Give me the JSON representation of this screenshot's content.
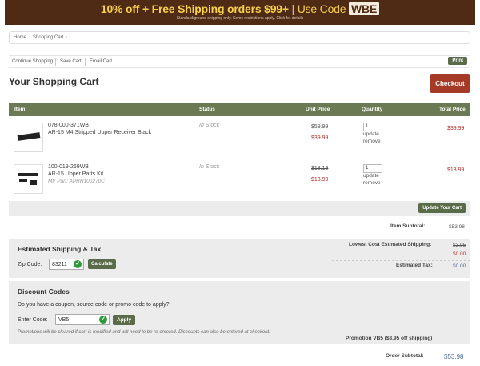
{
  "banner": {
    "headline_a": "10% off",
    "headline_plus": " + ",
    "headline_b": "Free Shipping orders $99+",
    "headline_sep": " | ",
    "headline_code_prefix": "Use Code ",
    "code": "WBE",
    "subtext": "Standard/ground shipping only. Some restrictions apply. Click for details"
  },
  "breadcrumb": [
    "Home",
    "Shopping Cart"
  ],
  "toolbar": {
    "continue": "Continue Shopping",
    "save": "Save Cart",
    "email": "Email Cart",
    "print": "Print"
  },
  "page_title": "Your Shopping Cart",
  "checkout_label": "Checkout",
  "table": {
    "headers": {
      "item": "Item",
      "status": "Status",
      "unit_price": "Unit Price",
      "quantity": "Quantity",
      "total": "Total Price"
    },
    "rows": [
      {
        "sku": "078-000-371WB",
        "name": "AR-15 M4 Stripped Upper Receiver Black",
        "mfr": "",
        "status": "In Stock",
        "old_price": "$59.99",
        "price": "$39.99",
        "qty": "1",
        "update": "update",
        "remove": "remove",
        "total": "$39.99"
      },
      {
        "sku": "100-019-269WB",
        "name": "AR-15 Upper Parts Kit",
        "mfr": "Mfr Part: APRH100270C",
        "status": "In Stock",
        "old_price": "$18.19",
        "price": "$13.99",
        "qty": "1",
        "update": "update",
        "remove": "remove",
        "total": "$13.99"
      }
    ]
  },
  "update_cart": "Update Your Cart",
  "item_subtotal": {
    "label": "Item Subtotal:",
    "value": "$53.98"
  },
  "shipping": {
    "title": "Estimated Shipping & Tax",
    "zip_label": "Zip Code:",
    "zip_value": "83211",
    "calculate": "Calculate",
    "lowest_label": "Lowest Cost Estimated Shipping:",
    "lowest_old": "$3.95",
    "lowest_new": "$0.00",
    "tax_label": "Estimated Tax:",
    "tax_value": "$0.00"
  },
  "discount": {
    "title": "Discount Codes",
    "question": "Do you have a coupon, source code or promo code to apply?",
    "enter_label": "Enter Code:",
    "code_value": "VB5",
    "apply": "Apply",
    "note": "Promotions will be cleared if cart is modified and will need to be re-entered. Discounts can also be entered at checkout.",
    "promo_line": "Promotion VB5 ($3.95 off shipping)"
  },
  "order_subtotal": {
    "label": "Order Subtotal:",
    "value": "$53.98"
  },
  "colors": {
    "banner": "#4f2a15",
    "accent_yellow": "#f6d04d",
    "header_olive": "#6b7a53",
    "button_olive": "#5a6b4a",
    "checkout_red": "#a53a27",
    "price_red": "#b0312a"
  }
}
